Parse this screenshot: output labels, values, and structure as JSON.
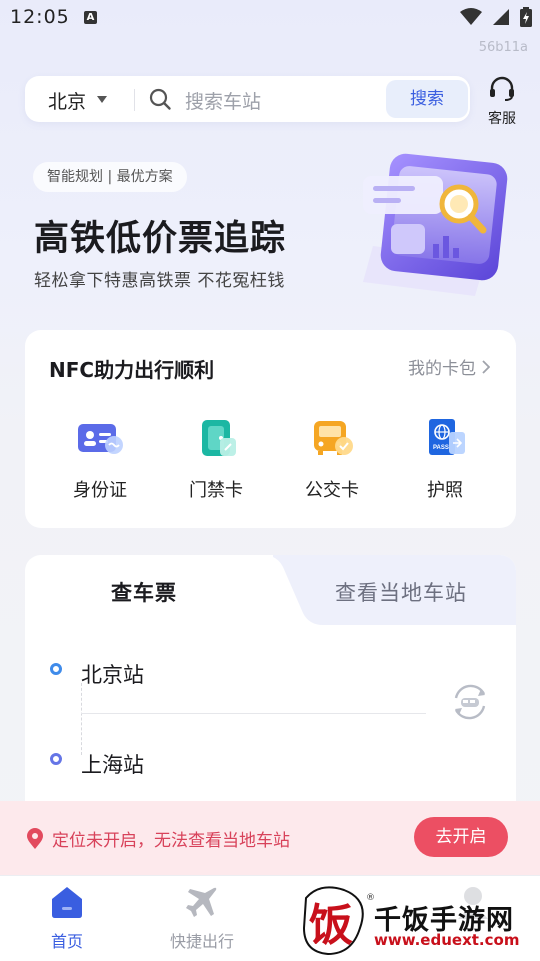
{
  "status": {
    "time": "12:05",
    "notification_letter": "A",
    "build_id": "56b11a"
  },
  "search": {
    "city": "北京",
    "placeholder": "搜索车站",
    "button": "搜索"
  },
  "service": {
    "label": "客服"
  },
  "banner": {
    "tag": "智能规划 | 最优方案",
    "title": "高铁低价票追踪",
    "subtitle": "轻松拿下特惠高铁票 不花冤枉钱"
  },
  "nfc": {
    "title": "NFC助力出行顺利",
    "wallet_link": "我的卡包",
    "items": [
      {
        "label": "身份证",
        "icon": "id-card-icon"
      },
      {
        "label": "门禁卡",
        "icon": "access-card-icon"
      },
      {
        "label": "公交卡",
        "icon": "bus-card-icon"
      },
      {
        "label": "护照",
        "icon": "passport-icon"
      }
    ]
  },
  "tickets": {
    "tabs": [
      "查车票",
      "查看当地车站"
    ],
    "from": "北京站",
    "to": "上海站"
  },
  "location_notice": {
    "text": "定位未开启，无法查看当地车站",
    "button": "去开启"
  },
  "nav": {
    "items": [
      {
        "label": "首页",
        "active": true
      },
      {
        "label": "快捷出行",
        "active": false
      },
      {
        "label": "",
        "active": false
      },
      {
        "label": "",
        "active": false
      }
    ]
  },
  "watermark": {
    "text": "千饭手游网",
    "url": "www.eduext.com",
    "glyph": "饭"
  },
  "colors": {
    "accent": "#3a5ee0",
    "alert": "#ec4f63",
    "alert_bg": "#fde9ec"
  }
}
